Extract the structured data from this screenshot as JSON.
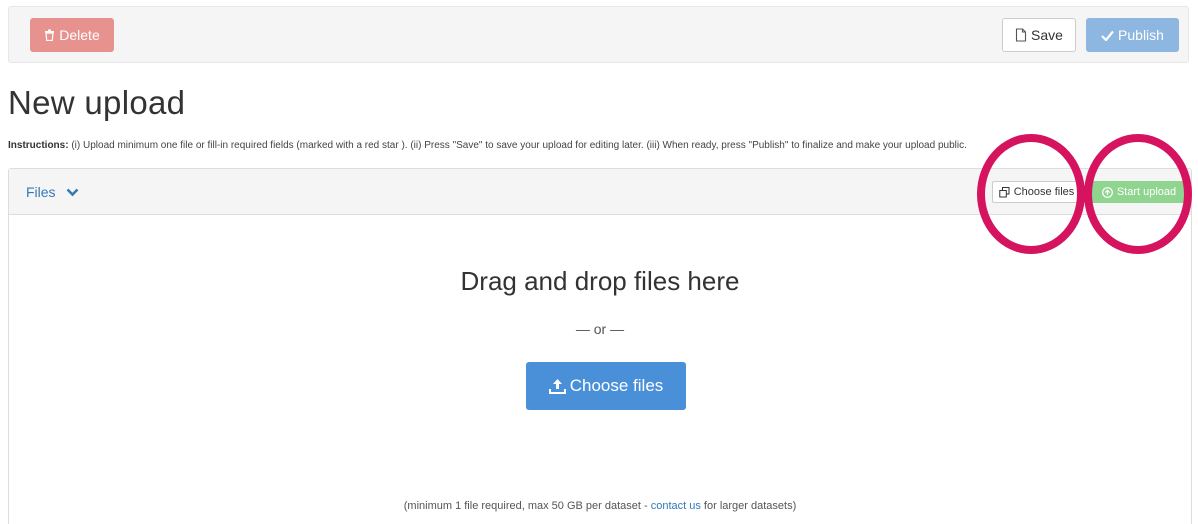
{
  "toolbar": {
    "delete_label": "Delete",
    "save_label": "Save",
    "publish_label": "Publish"
  },
  "page": {
    "title": "New upload"
  },
  "instructions": {
    "label": "Instructions:",
    "text": "(i) Upload minimum one file or fill-in required fields (marked with a red star ). (ii) Press \"Save\" to save your upload for editing later. (iii) When ready, press \"Publish\" to finalize and make your upload public."
  },
  "files_panel": {
    "tab_label": "Files",
    "choose_files_label": "Choose files",
    "start_upload_label": "Start upload",
    "drop_title": "Drag and drop files here",
    "or_text": "— or —",
    "choose_files_big_label": "Choose files",
    "footnote_prefix": "(minimum 1 file required, max 50 GB per dataset - ",
    "footnote_link": "contact us",
    "footnote_suffix": " for larger datasets)"
  },
  "colors": {
    "delete_bg": "#e8928f",
    "publish_bg": "#8db6e1",
    "start_upload_bg": "#8fd48f",
    "primary_blue": "#4a90d9",
    "highlight_ring": "#d6135e"
  },
  "icons": {
    "delete": "trash-icon",
    "save": "document-icon",
    "publish": "check-icon",
    "files_toggle": "chevron-down-icon",
    "choose_small": "copy-icon",
    "start_upload": "upload-circle-icon",
    "choose_big": "upload-icon"
  }
}
